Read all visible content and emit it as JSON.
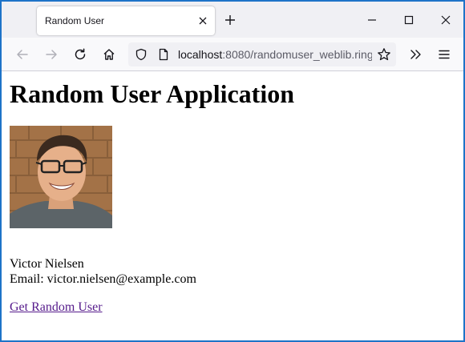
{
  "browser": {
    "tab": {
      "title": "Random User",
      "close_icon": "close-icon"
    },
    "new_tab_icon": "plus-icon",
    "window_controls": [
      "minimize-icon",
      "maximize-icon",
      "close-icon"
    ],
    "toolbar": {
      "back_icon": "arrow-left-icon",
      "forward_icon": "arrow-right-icon",
      "reload_icon": "reload-icon",
      "home_icon": "home-icon",
      "overflow_icon": "chevrons-right-icon",
      "menu_icon": "hamburger-icon"
    },
    "address_bar": {
      "host": "localhost",
      "rest": ":8080/randomuser_weblib.ring",
      "shield_icon": "shield-icon",
      "page_icon": "page-icon",
      "bookmark_icon": "star-icon"
    }
  },
  "page": {
    "title": "Random User Application",
    "user": {
      "name": "Victor Nielsen",
      "email_line": "Email: victor.nielsen@example.com"
    },
    "link_label": "Get Random User"
  },
  "colors": {
    "window_border": "#1e73c8",
    "tab_strip": "#f0f0f4",
    "toolbar": "#f9f9fb",
    "visited_link": "#551a8b"
  }
}
